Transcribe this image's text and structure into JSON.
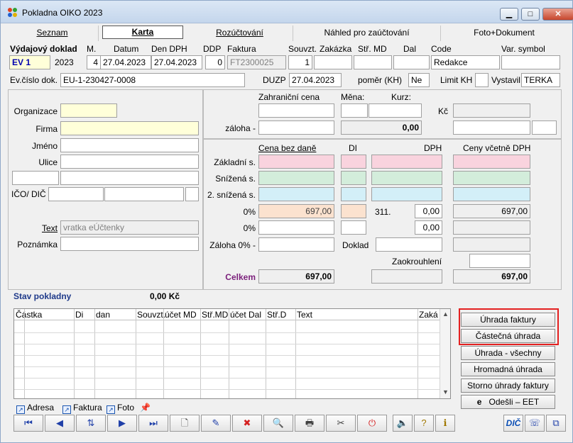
{
  "window": {
    "title": "Pokladna OIKO  2023"
  },
  "tabs": [
    "Seznam",
    "Karta",
    "Rozúčtování",
    "Náhled pro zaúčtování",
    "Foto+Dokument"
  ],
  "header": {
    "doc_type_label": "Výdajový doklad",
    "labels": {
      "m": "M.",
      "datum": "Datum",
      "den_dph": "Den DPH",
      "ddp": "DDP",
      "faktura": "Faktura",
      "souvzt": "Souvzt.",
      "zakazka": "Zakázka",
      "str_md": "Stř. MD",
      "dal": "Dal",
      "code": "Code",
      "var_symbol": "Var. symbol"
    },
    "values": {
      "ev": "EV  1",
      "year": "2023",
      "m": "4",
      "datum": "27.04.2023",
      "den_dph": "27.04.2023",
      "ddp": "0",
      "faktura": "FT2300025",
      "souvzt": "1",
      "code": "Redakce"
    },
    "ev_cislo_label": "Ev.číslo dok.",
    "ev_cislo": "EU-1-230427-0008",
    "duzp_label": "DUZP",
    "duzp": "27.04.2023",
    "pomer_label": "poměr (KH)",
    "pomer": "Ne",
    "limit_label": "Limit KH",
    "vystavil_label": "Vystavil",
    "vystavil": "TERKA"
  },
  "left": {
    "organizace": "Organizace",
    "firma": "Firma",
    "jmeno": "Jméno",
    "ulice": "Ulice",
    "ico": "IČO/ DIČ",
    "text_label": "Text",
    "text_value": "vratka eÚčtenky",
    "poznamka": "Poznámka"
  },
  "currency": {
    "zahranicni": "Zahraniční cena",
    "mena": "Měna:",
    "kurz": "Kurz:",
    "kc": "Kč",
    "zaloha": "záloha -",
    "zaloha_value": "0,00"
  },
  "vat": {
    "col_base": "Cena bez daně",
    "col_di": "DI",
    "col_dph": "DPH",
    "col_incl": "Ceny včetně DPH",
    "rows": [
      "Základní s.",
      "Snížená s.",
      "2. snížená s."
    ],
    "zero1": "0%",
    "zero1_base": "697,00",
    "acc": "311.",
    "acc_val": "0,00",
    "zero1_incl": "697,00",
    "zero2": "0%",
    "zero2_val": "0,00",
    "zaloha0": "Záloha 0% -",
    "doklad": "Doklad",
    "zaokrouhleni": "Zaokrouhlení",
    "celkem": "Celkem",
    "celkem_base": "697,00",
    "celkem_incl": "697,00"
  },
  "stav": {
    "label": "Stav pokladny",
    "value": "0,00 Kč"
  },
  "grid": {
    "columns": [
      "Částka",
      "Di",
      "dan",
      "Souvzt.",
      "účet MD",
      "Stř.MD",
      "účet Dal",
      "Stř.D",
      "Text",
      "Zaká"
    ]
  },
  "right_buttons": [
    "Úhrada faktury",
    "Částečná úhrada",
    "Úhrada - všechny",
    "Hromadná úhrada",
    "Storno úhrady faktury",
    "Odešli – EET"
  ],
  "links": [
    "Adresa",
    "Faktura",
    "Foto"
  ],
  "toolbar": {
    "dic": "DIČ"
  }
}
